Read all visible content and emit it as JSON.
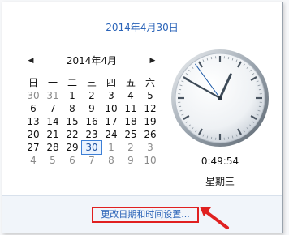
{
  "long_date": "2014年4月30日",
  "calendar": {
    "prev_icon": "◀",
    "next_icon": "▶",
    "month_title": "2014年4月",
    "weekdays": [
      "日",
      "一",
      "二",
      "三",
      "四",
      "五",
      "六"
    ],
    "weeks": [
      [
        {
          "d": "30",
          "other": true
        },
        {
          "d": "31",
          "other": true
        },
        {
          "d": "1"
        },
        {
          "d": "2"
        },
        {
          "d": "3"
        },
        {
          "d": "4"
        },
        {
          "d": "5"
        }
      ],
      [
        {
          "d": "6"
        },
        {
          "d": "7"
        },
        {
          "d": "8"
        },
        {
          "d": "9"
        },
        {
          "d": "10"
        },
        {
          "d": "11"
        },
        {
          "d": "12"
        }
      ],
      [
        {
          "d": "13"
        },
        {
          "d": "14"
        },
        {
          "d": "15"
        },
        {
          "d": "16"
        },
        {
          "d": "17"
        },
        {
          "d": "18"
        },
        {
          "d": "19"
        }
      ],
      [
        {
          "d": "20"
        },
        {
          "d": "21"
        },
        {
          "d": "22"
        },
        {
          "d": "23"
        },
        {
          "d": "24"
        },
        {
          "d": "25"
        },
        {
          "d": "26"
        }
      ],
      [
        {
          "d": "27"
        },
        {
          "d": "28"
        },
        {
          "d": "29"
        },
        {
          "d": "30",
          "today": true
        },
        {
          "d": "1",
          "other": true
        },
        {
          "d": "2",
          "other": true
        },
        {
          "d": "3",
          "other": true
        }
      ],
      [
        {
          "d": "4",
          "other": true
        },
        {
          "d": "5",
          "other": true
        },
        {
          "d": "6",
          "other": true
        },
        {
          "d": "7",
          "other": true
        },
        {
          "d": "8",
          "other": true
        },
        {
          "d": "9",
          "other": true
        },
        {
          "d": "10",
          "other": true
        }
      ]
    ]
  },
  "clock": {
    "time": "0:49:54",
    "weekday": "星期三"
  },
  "footer": {
    "link_label": "更改日期和时间设置..."
  },
  "colors": {
    "accent_link": "#2a63b8",
    "highlight_red": "#e02020",
    "today_border": "#3c7fd6"
  }
}
